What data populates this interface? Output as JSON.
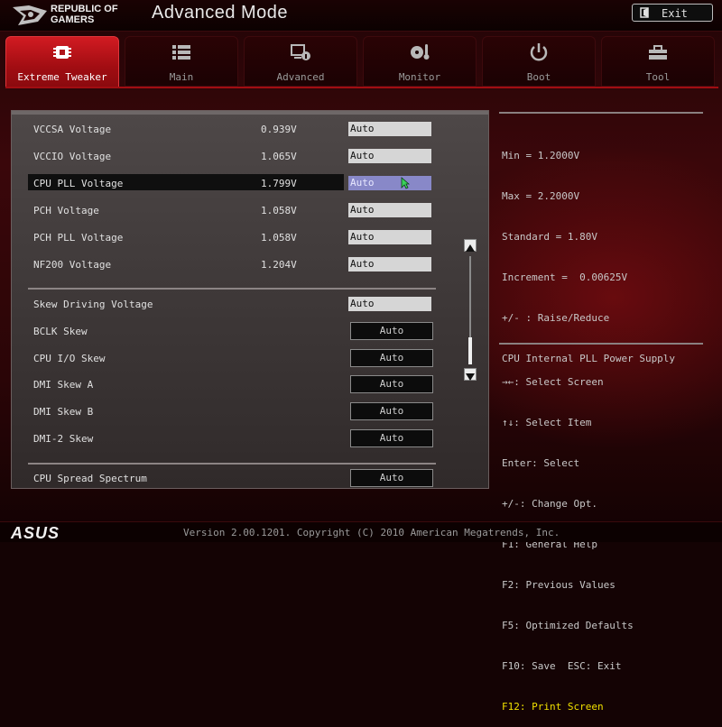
{
  "header": {
    "brand_line1": "REPUBLIC OF",
    "brand_line2": "GAMERS",
    "title": "Advanced Mode",
    "exit_label": "Exit"
  },
  "tabs": [
    {
      "label": "Extreme Tweaker",
      "icon": "chip-icon",
      "active": true
    },
    {
      "label": "Main",
      "icon": "list-icon",
      "active": false
    },
    {
      "label": "Advanced",
      "icon": "advanced-settings-icon",
      "active": false
    },
    {
      "label": "Monitor",
      "icon": "thermometer-fan-icon",
      "active": false
    },
    {
      "label": "Boot",
      "icon": "power-icon",
      "active": false
    },
    {
      "label": "Tool",
      "icon": "toolbox-icon",
      "active": false
    }
  ],
  "settings": {
    "group1": [
      {
        "label": "VCCSA Voltage",
        "value": "0.939V",
        "option": "Auto"
      },
      {
        "label": "VCCIO Voltage",
        "value": "1.065V",
        "option": "Auto"
      },
      {
        "label": "CPU PLL Voltage",
        "value": "1.799V",
        "option": "Auto"
      },
      {
        "label": "PCH Voltage",
        "value": "1.058V",
        "option": "Auto"
      },
      {
        "label": "PCH PLL Voltage",
        "value": "1.058V",
        "option": "Auto"
      },
      {
        "label": "NF200 Voltage",
        "value": "1.204V",
        "option": "Auto"
      }
    ],
    "group2": [
      {
        "label": "Skew Driving Voltage",
        "option": "Auto"
      },
      {
        "label": "BCLK Skew",
        "option": "Auto"
      },
      {
        "label": "CPU I/O Skew",
        "option": "Auto"
      },
      {
        "label": "DMI Skew A",
        "option": "Auto"
      },
      {
        "label": "DMI Skew B",
        "option": "Auto"
      },
      {
        "label": "DMI-2 Skew",
        "option": "Auto"
      }
    ],
    "group3": [
      {
        "label": "CPU Spread Spectrum",
        "option": "Auto"
      }
    ]
  },
  "help": {
    "lines": [
      "Min = 1.2000V",
      "Max = 2.2000V",
      "Standard = 1.80V",
      "Increment =  0.00625V",
      "+/- : Raise/Reduce",
      "CPU Internal PLL Power Supply"
    ]
  },
  "keys": {
    "lines": [
      "→←: Select Screen",
      "↑↓: Select Item",
      "Enter: Select",
      "+/-: Change Opt.",
      "F1: General Help",
      "F2: Previous Values",
      "F5: Optimized Defaults",
      "F10: Save  ESC: Exit"
    ],
    "highlight_line": "F12: Print Screen",
    "highlight_color": "#f0e000"
  },
  "footer": {
    "brand": "ASUS",
    "version": "Version 2.00.1201. Copyright (C) 2010 American Megatrends, Inc."
  },
  "colors": {
    "accent": "#c4141b",
    "selected_option": "#8888c8"
  }
}
